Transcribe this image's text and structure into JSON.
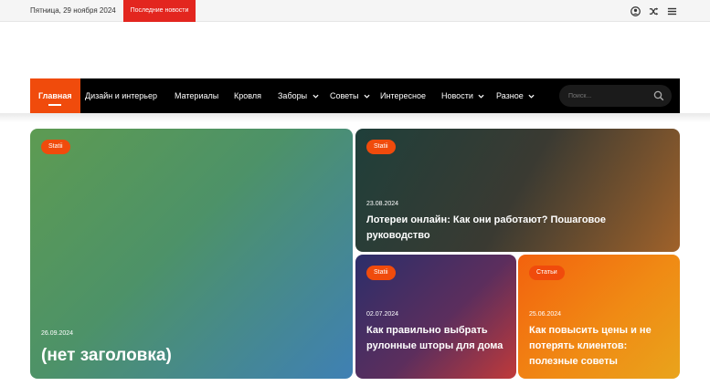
{
  "topbar": {
    "date": "Пятница, 29 ноября 2024",
    "latest_news": "Последние новости"
  },
  "icons": {
    "account": "user-circle-icon",
    "shuffle": "shuffle-icon",
    "menu": "hamburger-menu-icon"
  },
  "nav": {
    "items": [
      {
        "label": "Главная",
        "active": true,
        "dropdown": false
      },
      {
        "label": "Дизайн и интерьер",
        "active": false,
        "dropdown": false
      },
      {
        "label": "Материалы",
        "active": false,
        "dropdown": false
      },
      {
        "label": "Кровля",
        "active": false,
        "dropdown": false
      },
      {
        "label": "Заборы",
        "active": false,
        "dropdown": true
      },
      {
        "label": "Советы",
        "active": false,
        "dropdown": true
      },
      {
        "label": "Интересное",
        "active": false,
        "dropdown": false
      },
      {
        "label": "Новости",
        "active": false,
        "dropdown": true
      },
      {
        "label": "Разное",
        "active": false,
        "dropdown": true
      }
    ],
    "search_placeholder": "Поиск..."
  },
  "cards": [
    {
      "badge": "Statii",
      "date": "26.09.2024",
      "title": "(нет заголовка)"
    },
    {
      "badge": "Statii",
      "date": "23.08.2024",
      "title": "Лотереи онлайн: Как они работают? Пошаговое руководство"
    },
    {
      "badge": "Statii",
      "date": "02.07.2024",
      "title": "Как правильно выбрать рулонные шторы для дома"
    },
    {
      "badge": "Статьи",
      "date": "25.06.2024",
      "title": "Как повысить цены и не потерять клиентов: полезные советы"
    }
  ],
  "colors": {
    "accent": "#f04b0c",
    "latest_news_bg": "#e3261f",
    "nav_bg": "#000000"
  }
}
